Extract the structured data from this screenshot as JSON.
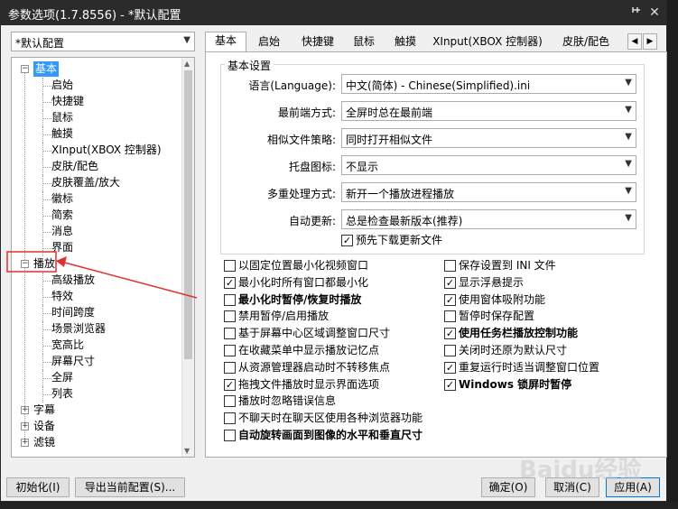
{
  "window": {
    "title": "参数选项(1.7.8556) - *默认配置",
    "pin_icon": "pin-icon",
    "close_label": "✕"
  },
  "profile": {
    "selected": "*默认配置"
  },
  "tree": {
    "nodes": [
      {
        "label": "基本",
        "level": 0,
        "expander": "−",
        "selected": true
      },
      {
        "label": "启始",
        "level": 1
      },
      {
        "label": "快捷键",
        "level": 1
      },
      {
        "label": "鼠标",
        "level": 1
      },
      {
        "label": "触摸",
        "level": 1
      },
      {
        "label": "XInput(XBOX 控制器)",
        "level": 1
      },
      {
        "label": "皮肤/配色",
        "level": 1
      },
      {
        "label": "皮肤覆盖/放大",
        "level": 1
      },
      {
        "label": "徽标",
        "level": 1
      },
      {
        "label": "简索",
        "level": 1
      },
      {
        "label": "消息",
        "level": 1
      },
      {
        "label": "界面",
        "level": 1
      },
      {
        "label": "播放",
        "level": 0,
        "expander": "−"
      },
      {
        "label": "高级播放",
        "level": 1
      },
      {
        "label": "特效",
        "level": 1
      },
      {
        "label": "时间跨度",
        "level": 1
      },
      {
        "label": "场景浏览器",
        "level": 1
      },
      {
        "label": "宽高比",
        "level": 1
      },
      {
        "label": "屏幕尺寸",
        "level": 1
      },
      {
        "label": "全屏",
        "level": 1
      },
      {
        "label": "列表",
        "level": 1
      },
      {
        "label": "字幕",
        "level": 0,
        "expander": "+"
      },
      {
        "label": "设备",
        "level": 0,
        "expander": "+"
      },
      {
        "label": "滤镜",
        "level": 0,
        "expander": "+"
      }
    ]
  },
  "tabs": [
    "基本",
    "启始",
    "快捷键",
    "鼠标",
    "触摸",
    "XInput(XBOX 控制器)",
    "皮肤/配色"
  ],
  "active_tab": "基本",
  "settings": {
    "group_title": "基本设置",
    "rows": [
      {
        "label": "语言(Language):",
        "value": "中文(简体) - Chinese(Simplified).ini"
      },
      {
        "label": "最前端方式:",
        "value": "全屏时总在最前端"
      },
      {
        "label": "相似文件策略:",
        "value": "同时打开相似文件"
      },
      {
        "label": "托盘图标:",
        "value": "不显示"
      },
      {
        "label": "多重处理方式:",
        "value": "新开一个播放进程播放"
      },
      {
        "label": "自动更新:",
        "value": "总是检查最新版本(推荐)"
      }
    ],
    "predownload": {
      "label": "预先下载更新文件",
      "checked": true
    }
  },
  "options_left": [
    {
      "label": "以固定位置最小化视频窗口",
      "checked": false,
      "bold": false
    },
    {
      "label": "最小化时所有窗口都最小化",
      "checked": true,
      "bold": false
    },
    {
      "label": "最小化时暂停/恢复时播放",
      "checked": false,
      "bold": true
    },
    {
      "label": "禁用暂停/启用播放",
      "checked": false,
      "bold": false
    },
    {
      "label": "基于屏幕中心区域调整窗口尺寸",
      "checked": false,
      "bold": false
    },
    {
      "label": "在收藏菜单中显示播放记忆点",
      "checked": false,
      "bold": false
    },
    {
      "label": "从资源管理器启动时不转移焦点",
      "checked": false,
      "bold": false
    },
    {
      "label": "拖拽文件播放时显示界面选项",
      "checked": true,
      "bold": false
    },
    {
      "label": "播放时忽略错误信息",
      "checked": false,
      "bold": false
    },
    {
      "label": "不聊天时在聊天区使用各种浏览器功能",
      "checked": false,
      "bold": false
    },
    {
      "label": "自动旋转画面到图像的水平和垂直尺寸",
      "checked": false,
      "bold": true
    }
  ],
  "options_right": [
    {
      "label": "保存设置到 INI 文件",
      "checked": false,
      "bold": false
    },
    {
      "label": "显示浮悬提示",
      "checked": true,
      "bold": false
    },
    {
      "label": "使用窗体吸附功能",
      "checked": true,
      "bold": false
    },
    {
      "label": "暂停时保存配置",
      "checked": false,
      "bold": false
    },
    {
      "label": "使用任务栏播放控制功能",
      "checked": true,
      "bold": true
    },
    {
      "label": "关闭时还原为默认尺寸",
      "checked": false,
      "bold": false
    },
    {
      "label": "重复运行时适当调整窗口位置",
      "checked": true,
      "bold": false
    },
    {
      "label": "Windows 锁屏时暂停",
      "checked": true,
      "bold": true
    }
  ],
  "buttons": {
    "init": "初始化(I)",
    "export": "导出当前配置(S)...",
    "ok": "确定(O)",
    "cancel": "取消(C)",
    "apply": "应用(A)"
  },
  "watermark": "Baidu经验"
}
